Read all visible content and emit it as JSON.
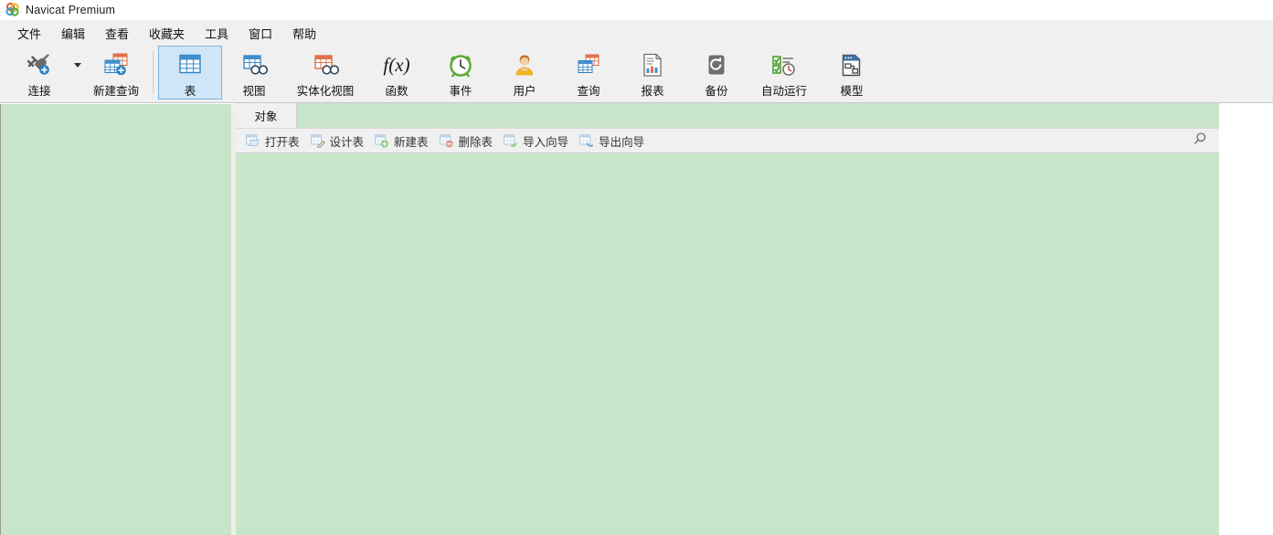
{
  "window": {
    "title": "Navicat Premium",
    "logo_icon": "navicat-logo-icon"
  },
  "menubar": {
    "items": [
      {
        "label": "文件",
        "name": "menu-file"
      },
      {
        "label": "编辑",
        "name": "menu-edit"
      },
      {
        "label": "查看",
        "name": "menu-view"
      },
      {
        "label": "收藏夹",
        "name": "menu-favorites"
      },
      {
        "label": "工具",
        "name": "menu-tools"
      },
      {
        "label": "窗口",
        "name": "menu-window"
      },
      {
        "label": "帮助",
        "name": "menu-help"
      }
    ]
  },
  "ribbon": {
    "buttons": [
      {
        "label": "连接",
        "icon": "connection-plug-icon",
        "selected": false
      },
      {
        "label": "新建查询",
        "icon": "new-query-icon",
        "selected": false
      },
      {
        "label": "表",
        "icon": "table-icon",
        "selected": true
      },
      {
        "label": "视图",
        "icon": "view-icon",
        "selected": false
      },
      {
        "label": "实体化视图",
        "icon": "materialized-view-icon",
        "selected": false
      },
      {
        "label": "函数",
        "icon": "function-fx-icon",
        "selected": false
      },
      {
        "label": "事件",
        "icon": "event-clock-icon",
        "selected": false
      },
      {
        "label": "用户",
        "icon": "user-icon",
        "selected": false
      },
      {
        "label": "查询",
        "icon": "query-icon",
        "selected": false
      },
      {
        "label": "报表",
        "icon": "report-icon",
        "selected": false
      },
      {
        "label": "备份",
        "icon": "backup-icon",
        "selected": false
      },
      {
        "label": "自动运行",
        "icon": "automation-icon",
        "selected": false
      },
      {
        "label": "模型",
        "icon": "model-icon",
        "selected": false
      }
    ],
    "connection_dropdown_icon": "chevron-down-icon"
  },
  "tabs": [
    {
      "label": "对象",
      "active": true
    }
  ],
  "object_toolbar": {
    "buttons": [
      {
        "label": "打开表",
        "icon": "open-table-icon"
      },
      {
        "label": "设计表",
        "icon": "design-table-icon"
      },
      {
        "label": "新建表",
        "icon": "new-table-icon"
      },
      {
        "label": "删除表",
        "icon": "delete-table-icon"
      },
      {
        "label": "导入向导",
        "icon": "import-wizard-icon"
      },
      {
        "label": "导出向导",
        "icon": "export-wizard-icon"
      }
    ],
    "search_icon": "search-icon"
  },
  "panels": {
    "sidebar_empty": "",
    "object_list_empty": ""
  },
  "colors": {
    "panel_green": "#c9e5c9",
    "toolbar_gray": "#f0f0f0",
    "selected_blue": "#cfe6f8",
    "selected_border": "#7eb4dd"
  }
}
